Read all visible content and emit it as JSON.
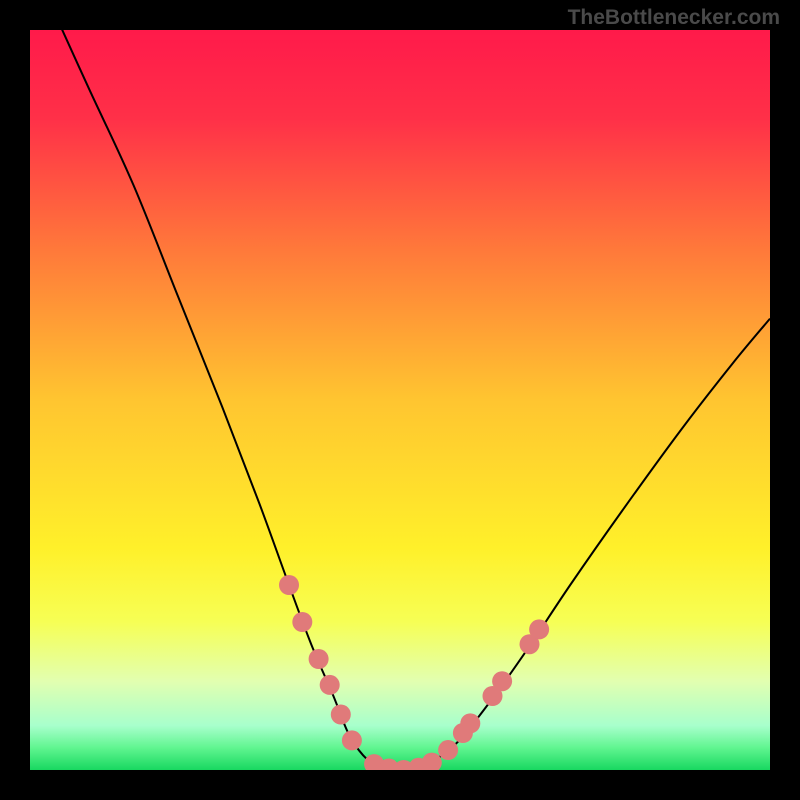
{
  "watermark": "TheBottlenecker.com",
  "chart_data": {
    "type": "line",
    "title": "",
    "xlabel": "",
    "ylabel": "",
    "xlim": [
      0,
      100
    ],
    "ylim": [
      0,
      100
    ],
    "background_gradient": {
      "stops": [
        {
          "offset": 0.0,
          "color": "#ff1a4a"
        },
        {
          "offset": 0.12,
          "color": "#ff3048"
        },
        {
          "offset": 0.3,
          "color": "#ff7a3a"
        },
        {
          "offset": 0.5,
          "color": "#ffc530"
        },
        {
          "offset": 0.7,
          "color": "#fff02a"
        },
        {
          "offset": 0.8,
          "color": "#f6ff55"
        },
        {
          "offset": 0.88,
          "color": "#e2ffb0"
        },
        {
          "offset": 0.94,
          "color": "#a8ffcc"
        },
        {
          "offset": 0.97,
          "color": "#60f590"
        },
        {
          "offset": 1.0,
          "color": "#18d860"
        }
      ]
    },
    "series": [
      {
        "name": "bottleneck-curve",
        "type": "line",
        "color": "#000000",
        "points": [
          {
            "x": 3,
            "y": 103
          },
          {
            "x": 8,
            "y": 92
          },
          {
            "x": 14,
            "y": 79
          },
          {
            "x": 20,
            "y": 64
          },
          {
            "x": 26,
            "y": 49
          },
          {
            "x": 31,
            "y": 36
          },
          {
            "x": 35,
            "y": 25
          },
          {
            "x": 38,
            "y": 17
          },
          {
            "x": 41,
            "y": 10
          },
          {
            "x": 43,
            "y": 5
          },
          {
            "x": 45,
            "y": 2
          },
          {
            "x": 47,
            "y": 0.5
          },
          {
            "x": 49,
            "y": 0
          },
          {
            "x": 51,
            "y": 0
          },
          {
            "x": 53,
            "y": 0.4
          },
          {
            "x": 55,
            "y": 1.5
          },
          {
            "x": 58,
            "y": 4
          },
          {
            "x": 62,
            "y": 9
          },
          {
            "x": 67,
            "y": 16
          },
          {
            "x": 73,
            "y": 25
          },
          {
            "x": 80,
            "y": 35
          },
          {
            "x": 88,
            "y": 46
          },
          {
            "x": 95,
            "y": 55
          },
          {
            "x": 100,
            "y": 61
          }
        ]
      },
      {
        "name": "data-points",
        "type": "scatter",
        "color": "#e07a7a",
        "points": [
          {
            "x": 35.0,
            "y": 25.0
          },
          {
            "x": 36.8,
            "y": 20.0
          },
          {
            "x": 39.0,
            "y": 15.0
          },
          {
            "x": 40.5,
            "y": 11.5
          },
          {
            "x": 42.0,
            "y": 7.5
          },
          {
            "x": 43.5,
            "y": 4.0
          },
          {
            "x": 46.5,
            "y": 0.8
          },
          {
            "x": 48.5,
            "y": 0.2
          },
          {
            "x": 50.5,
            "y": 0.0
          },
          {
            "x": 52.5,
            "y": 0.3
          },
          {
            "x": 54.3,
            "y": 1.0
          },
          {
            "x": 56.5,
            "y": 2.7
          },
          {
            "x": 58.5,
            "y": 5.0
          },
          {
            "x": 59.5,
            "y": 6.3
          },
          {
            "x": 62.5,
            "y": 10.0
          },
          {
            "x": 63.8,
            "y": 12.0
          },
          {
            "x": 67.5,
            "y": 17.0
          },
          {
            "x": 68.8,
            "y": 19.0
          }
        ]
      }
    ]
  }
}
